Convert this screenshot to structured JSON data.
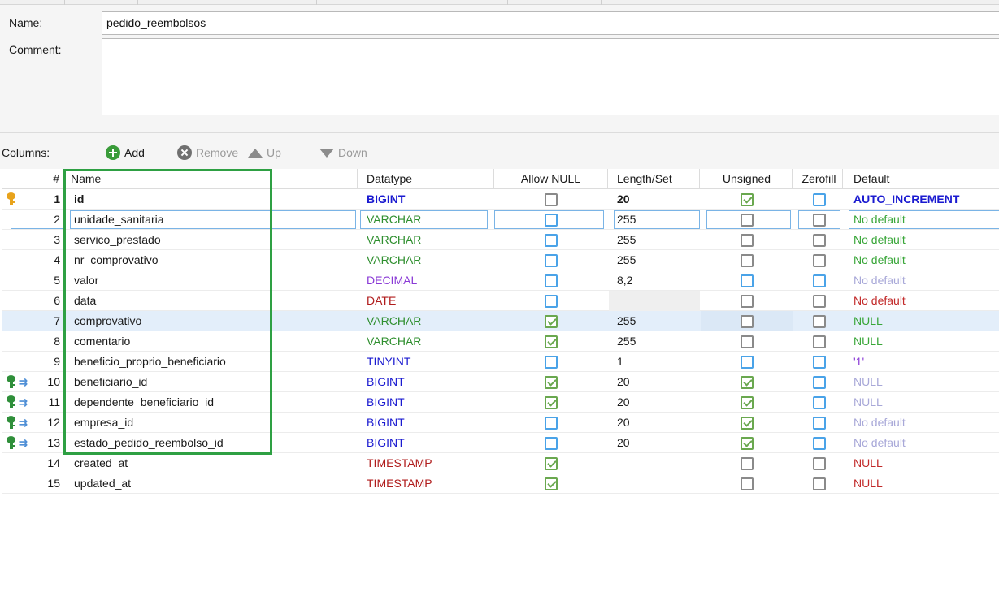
{
  "form": {
    "name_label": "Name:",
    "name_value": "pedido_reembolsos",
    "comment_label": "Comment:"
  },
  "toolbar": {
    "columns_label": "Columns:",
    "add_label": "Add",
    "remove_label": "Remove",
    "up_label": "Up",
    "down_label": "Down"
  },
  "grid": {
    "headers": {
      "num": "#",
      "name": "Name",
      "datatype": "Datatype",
      "allow_null": "Allow NULL",
      "length": "Length/Set",
      "unsigned": "Unsigned",
      "zerofill": "Zerofill",
      "default": "Default"
    },
    "rows": [
      {
        "num": "1",
        "name": "id",
        "datatype": "BIGINT",
        "allow_null": false,
        "length": "20",
        "unsigned": true,
        "zerofill": false,
        "default": "AUTO_INCREMENT"
      },
      {
        "num": "2",
        "name": "unidade_sanitaria",
        "datatype": "VARCHAR",
        "allow_null": false,
        "length": "255",
        "unsigned": false,
        "zerofill": false,
        "default": "No default"
      },
      {
        "num": "3",
        "name": "servico_prestado",
        "datatype": "VARCHAR",
        "allow_null": false,
        "length": "255",
        "unsigned": false,
        "zerofill": false,
        "default": "No default"
      },
      {
        "num": "4",
        "name": "nr_comprovativo",
        "datatype": "VARCHAR",
        "allow_null": false,
        "length": "255",
        "unsigned": false,
        "zerofill": false,
        "default": "No default"
      },
      {
        "num": "5",
        "name": "valor",
        "datatype": "DECIMAL",
        "allow_null": false,
        "length": "8,2",
        "unsigned": false,
        "zerofill": false,
        "default": "No default"
      },
      {
        "num": "6",
        "name": "data",
        "datatype": "DATE",
        "allow_null": false,
        "length": "",
        "unsigned": false,
        "zerofill": false,
        "default": "No default"
      },
      {
        "num": "7",
        "name": "comprovativo",
        "datatype": "VARCHAR",
        "allow_null": true,
        "length": "255",
        "unsigned": false,
        "zerofill": false,
        "default": "NULL"
      },
      {
        "num": "8",
        "name": "comentario",
        "datatype": "VARCHAR",
        "allow_null": true,
        "length": "255",
        "unsigned": false,
        "zerofill": false,
        "default": "NULL"
      },
      {
        "num": "9",
        "name": "beneficio_proprio_beneficiario",
        "datatype": "TINYINT",
        "allow_null": false,
        "length": "1",
        "unsigned": false,
        "zerofill": false,
        "default": "'1'"
      },
      {
        "num": "10",
        "name": "beneficiario_id",
        "datatype": "BIGINT",
        "allow_null": true,
        "length": "20",
        "unsigned": true,
        "zerofill": false,
        "default": "NULL"
      },
      {
        "num": "11",
        "name": "dependente_beneficiario_id",
        "datatype": "BIGINT",
        "allow_null": true,
        "length": "20",
        "unsigned": true,
        "zerofill": false,
        "default": "NULL"
      },
      {
        "num": "12",
        "name": "empresa_id",
        "datatype": "BIGINT",
        "allow_null": false,
        "length": "20",
        "unsigned": true,
        "zerofill": false,
        "default": "No default"
      },
      {
        "num": "13",
        "name": "estado_pedido_reembolso_id",
        "datatype": "BIGINT",
        "allow_null": false,
        "length": "20",
        "unsigned": true,
        "zerofill": false,
        "default": "No default"
      },
      {
        "num": "14",
        "name": "created_at",
        "datatype": "TIMESTAMP",
        "allow_null": true,
        "length": "",
        "unsigned": false,
        "zerofill": false,
        "default": "NULL"
      },
      {
        "num": "15",
        "name": "updated_at",
        "datatype": "TIMESTAMP",
        "allow_null": true,
        "length": "",
        "unsigned": false,
        "zerofill": false,
        "default": "NULL"
      }
    ]
  },
  "colors": {
    "selection_frame": "#2ea043",
    "type_int": "#1a1ad0",
    "type_varchar": "#2f8f2f",
    "type_decimal": "#8a3ad6",
    "type_date": "#b01c1c",
    "default_green": "#39a639",
    "default_grey": "#a8a8d8",
    "default_red": "#c22a2a"
  }
}
